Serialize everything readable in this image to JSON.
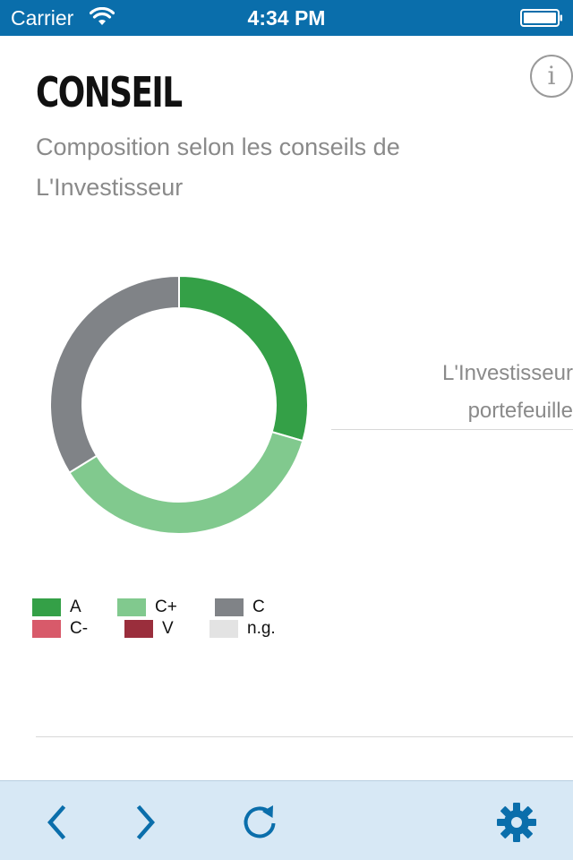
{
  "status_bar": {
    "carrier": "Carrier",
    "time": "4:34 PM",
    "icons": [
      "wifi-icon",
      "battery-icon"
    ]
  },
  "header": {
    "title": "CONSEIL",
    "info_label": "i",
    "subtitle_line1": "Composition selon les conseils de",
    "subtitle_line2": "L'Investisseur"
  },
  "side_panel": {
    "line1": "L'Investisseur",
    "line2": "portefeuille"
  },
  "chart_data": {
    "type": "pie",
    "categories": [
      "A",
      "C+",
      "C",
      "C-",
      "V",
      "n.g."
    ],
    "values": [
      29.5,
      36.7,
      33.8,
      0,
      0,
      0
    ],
    "colors": [
      "#34a047",
      "#81c98e",
      "#808387",
      "#d85a6a",
      "#9a2e3c",
      "#e3e3e3"
    ],
    "legend_position": "bottom-left"
  },
  "legend": {
    "items": [
      {
        "label": "A",
        "color": "#34a047"
      },
      {
        "label": "C+",
        "color": "#81c98e"
      },
      {
        "label": "C",
        "color": "#808387"
      },
      {
        "label": "C-",
        "color": "#d85a6a"
      },
      {
        "label": "V",
        "color": "#9a2e3c"
      },
      {
        "label": "n.g.",
        "color": "#e3e3e3"
      }
    ]
  },
  "toolbar": {
    "accent": "#0a6eab",
    "buttons": [
      "chevron-left-icon",
      "chevron-right-icon",
      "refresh-icon",
      "gear-icon"
    ]
  }
}
